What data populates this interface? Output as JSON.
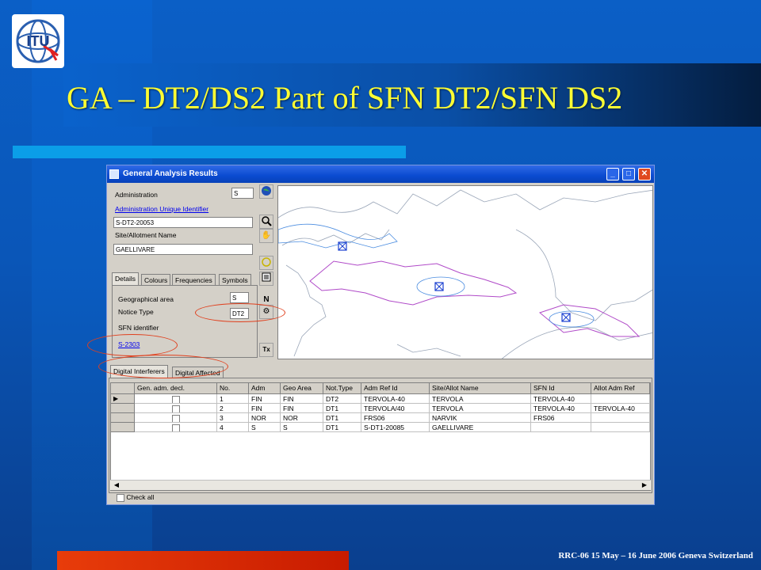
{
  "slide": {
    "title": "GA – DT2/DS2 Part of SFN DT2/SFN DS2",
    "footer": "RRC-06 15 May – 16 June 2006 Geneva Switzerland",
    "logo_text": "ITU"
  },
  "window": {
    "title": "General Analysis Results",
    "minimize": "_",
    "maximize": "□",
    "close": "✕"
  },
  "form": {
    "administration_label": "Administration",
    "administration_value": "S",
    "unique_id_link": "Administration Unique Identifier",
    "unique_id_value": "S-DT2-20053",
    "site_label": "Site/Allotment Name",
    "site_value": "GAELLIVARE"
  },
  "detail_tabs": [
    "Details",
    "Colours",
    "Frequencies",
    "Symbols"
  ],
  "details": {
    "geo_area_label": "Geographical area",
    "geo_area_value": "S",
    "notice_type_label": "Notice Type",
    "notice_type_value": "DT2",
    "sfn_label": "SFN identifier",
    "sfn_link": "S-2303"
  },
  "toolbar_tools": [
    "globe-icon",
    "zoom-icon",
    "hand-icon",
    "circle-icon",
    "list-icon",
    "N",
    "Tx"
  ],
  "lower_tabs": [
    "Digital Interferers",
    "Digital Affected"
  ],
  "grid": {
    "columns": [
      "Gen. adm. decl.",
      "No.",
      "Adm",
      "Geo Area",
      "Not.Type",
      "Adm Ref Id",
      "Site/Allot Name",
      "SFN Id",
      "Allot Adm Ref"
    ],
    "rows": [
      [
        "",
        "1",
        "FIN",
        "FIN",
        "DT2",
        "TERVOLA-40",
        "TERVOLA",
        "TERVOLA-40",
        ""
      ],
      [
        "",
        "2",
        "FIN",
        "FIN",
        "DT1",
        "TERVOLA/40",
        "TERVOLA",
        "TERVOLA-40",
        "TERVOLA-40"
      ],
      [
        "",
        "3",
        "NOR",
        "NOR",
        "DT1",
        "FRS06",
        "NARVIK",
        "FRS06",
        ""
      ],
      [
        "",
        "4",
        "S",
        "S",
        "DT1",
        "S-DT1-20085",
        "GAELLIVARE",
        "",
        ""
      ]
    ]
  },
  "check_all": "Check all",
  "colors": {
    "title": "#ffff33",
    "titlebar": "#0a4ad0",
    "annotation": "#e0401e",
    "map_coast": "#9aa6b8",
    "map_blue": "#4a8ce0",
    "map_purple": "#b04ac8"
  }
}
